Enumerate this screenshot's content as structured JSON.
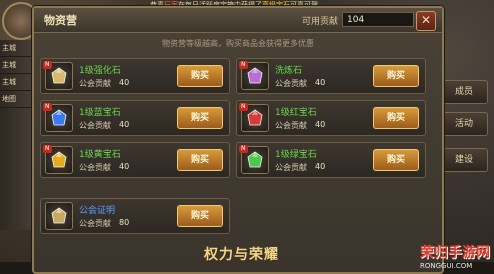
{
  "top_ticker": {
    "lead": "恭喜",
    "player": "玩家",
    "mid": "在每日活跃度宝箱中获得了",
    "item": "高级宝石",
    "tail": "可喜可贺"
  },
  "sidebar": {
    "labels": [
      "主城",
      "主城",
      "主城",
      "地图"
    ]
  },
  "right_buttons": [
    "成员",
    "活动",
    "建设"
  ],
  "panel": {
    "title": "物资营",
    "contrib_label": "可用贡献",
    "contrib_value": "104",
    "close": "✕",
    "notice": "物资营等级越高，购买商品会获得更多优惠"
  },
  "items": [
    {
      "name": "1级强化石",
      "cost_label": "公会贡献",
      "cost": "40",
      "buy": "购买",
      "color": "#e0c070"
    },
    {
      "name": "洗炼石",
      "cost_label": "公会贡献",
      "cost": "40",
      "buy": "购买",
      "color": "#c070e0"
    },
    {
      "name": "1级蓝宝石",
      "cost_label": "公会贡献",
      "cost": "40",
      "buy": "购买",
      "color": "#3a7cff"
    },
    {
      "name": "1级红宝石",
      "cost_label": "公会贡献",
      "cost": "40",
      "buy": "购买",
      "color": "#e03a3a"
    },
    {
      "name": "1级黄宝石",
      "cost_label": "公会贡献",
      "cost": "40",
      "buy": "购买",
      "color": "#f0b020"
    },
    {
      "name": "1级绿宝石",
      "cost_label": "公会贡献",
      "cost": "40",
      "buy": "购买",
      "color": "#4ed04e"
    },
    {
      "name": "公会证明",
      "cost_label": "公会贡献",
      "cost": "80",
      "buy": "购买",
      "color": "#d0b060"
    }
  ],
  "logo": "权力与荣耀",
  "watermark": {
    "main": "荣归手游网",
    "sub": "RONGGUI.COM"
  }
}
